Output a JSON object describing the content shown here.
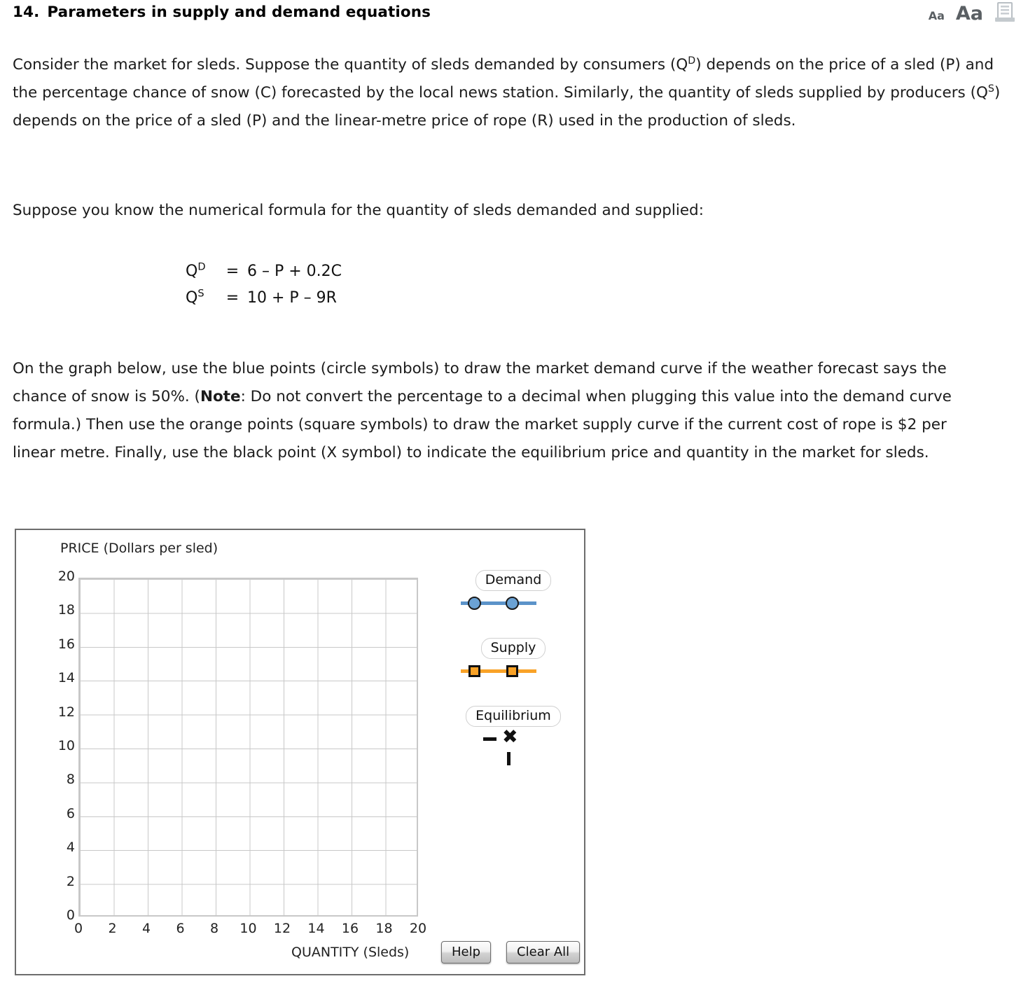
{
  "header": {
    "number": "14.",
    "title": "Parameters in supply and demand equations",
    "font_small_label": "Aa",
    "font_large_label": "Aa",
    "print_icon": "print-icon"
  },
  "paragraphs": {
    "p1_a": "Consider the market for sleds. Suppose the quantity of sleds demanded by consumers (Q",
    "p1_sup1": "D",
    "p1_b": ") depends on the price of a sled (P) and the percentage chance of snow (C) forecasted by the local news station. Similarly, the quantity of sleds supplied by producers (Q",
    "p1_sup2": "S",
    "p1_c": ") depends on the price of a sled (P) and the linear-metre price of rope (R) used in the production of sleds.",
    "p2": "Suppose you know the numerical formula for the quantity of sleds demanded and supplied:",
    "p3_a": "On the graph below, use the blue points (circle symbols) to draw the market demand curve if the weather forecast says the chance of snow is 50%. (",
    "p3_note": "Note",
    "p3_b": ": Do not convert the percentage to a decimal when plugging this value into the demand curve formula.) Then use the orange points (square symbols) to draw the market supply curve if the current cost of rope is $2 per linear metre. Finally, use the black point (X symbol) to indicate the equilibrium price and quantity in the market for sleds."
  },
  "equations": [
    {
      "lhs_base": "Q",
      "lhs_sup": "D",
      "eq": "=",
      "rhs": "6 – P + 0.2C"
    },
    {
      "lhs_base": "Q",
      "lhs_sup": "S",
      "eq": "=",
      "rhs": "10 + P – 9R"
    }
  ],
  "chart_data": {
    "type": "scatter",
    "title": "",
    "xlabel": "QUANTITY (Sleds)",
    "ylabel": "PRICE (Dollars per sled)",
    "xlim": [
      0,
      20
    ],
    "ylim": [
      0,
      20
    ],
    "xticks": [
      "0",
      "2",
      "4",
      "6",
      "8",
      "10",
      "12",
      "14",
      "16",
      "18",
      "20"
    ],
    "yticks": [
      "20",
      "18",
      "16",
      "14",
      "12",
      "10",
      "8",
      "6",
      "4",
      "2",
      "0"
    ],
    "grid": true,
    "legend_position": "right",
    "series": [
      {
        "name": "Demand",
        "marker": "circle",
        "color": "#5b93c9",
        "marker_fill": "#6ba2d4",
        "points": []
      },
      {
        "name": "Supply",
        "marker": "square",
        "color": "#f9a227",
        "marker_fill": "#f9a227",
        "points": []
      },
      {
        "name": "Equilibrium",
        "marker": "x",
        "color": "#111111",
        "marker_fill": "#111111",
        "points": []
      }
    ]
  },
  "legend": {
    "demand_label": "Demand",
    "supply_label": "Supply",
    "equilibrium_label": "Equilibrium",
    "equilibrium_symbol": "✖"
  },
  "controls": {
    "help_label": "Help",
    "clear_all_label": "Clear All"
  },
  "colors": {
    "demand_blue": "#5b93c9",
    "supply_orange": "#f9a227",
    "equilibrium_black": "#111111",
    "grid_gray": "#c8c8c8",
    "border_gray": "#6d6d6d"
  }
}
